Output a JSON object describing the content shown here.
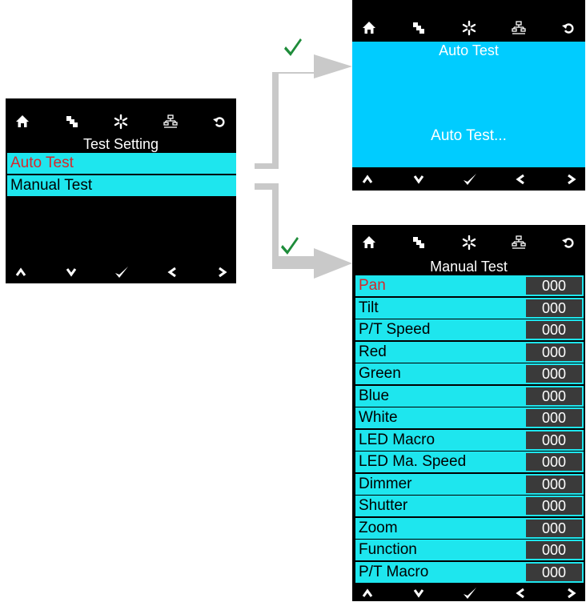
{
  "colors": {
    "screen_bg": "#000000",
    "row_bg": "#1ee6ee",
    "selected_text": "#d8262a",
    "value_bg": "#3a3a3a",
    "auto_bg": "#00ccff",
    "arrow": "#c9c9c9",
    "check": "#1e8c3a"
  },
  "top_icons": [
    "home-icon",
    "copy-icon",
    "fan-icon",
    "network-icon",
    "back-icon"
  ],
  "bottom_icons": [
    "up-icon",
    "down-icon",
    "check-icon",
    "left-icon",
    "right-icon"
  ],
  "left_screen": {
    "title": "Test Setting",
    "items": [
      {
        "label": "Auto Test",
        "selected": true
      },
      {
        "label": "Manual Test",
        "selected": false
      }
    ]
  },
  "auto_screen": {
    "title": "Auto Test",
    "status": "Auto Test..."
  },
  "manual_screen": {
    "title": "Manual Test",
    "rows": [
      {
        "label": "Pan",
        "value": "000",
        "selected": true
      },
      {
        "label": "Tilt",
        "value": "000"
      },
      {
        "label": "P/T Speed",
        "value": "000"
      },
      {
        "label": "Red",
        "value": "000"
      },
      {
        "label": "Green",
        "value": "000"
      },
      {
        "label": "Blue",
        "value": "000"
      },
      {
        "label": "White",
        "value": "000"
      },
      {
        "label": "LED Macro",
        "value": "000"
      },
      {
        "label": "LED Ma. Speed",
        "value": "000"
      },
      {
        "label": "Dimmer",
        "value": "000"
      },
      {
        "label": "Shutter",
        "value": "000"
      },
      {
        "label": "Zoom",
        "value": "000"
      },
      {
        "label": "Function",
        "value": "000"
      },
      {
        "label": "P/T Macro",
        "value": "000"
      }
    ]
  }
}
